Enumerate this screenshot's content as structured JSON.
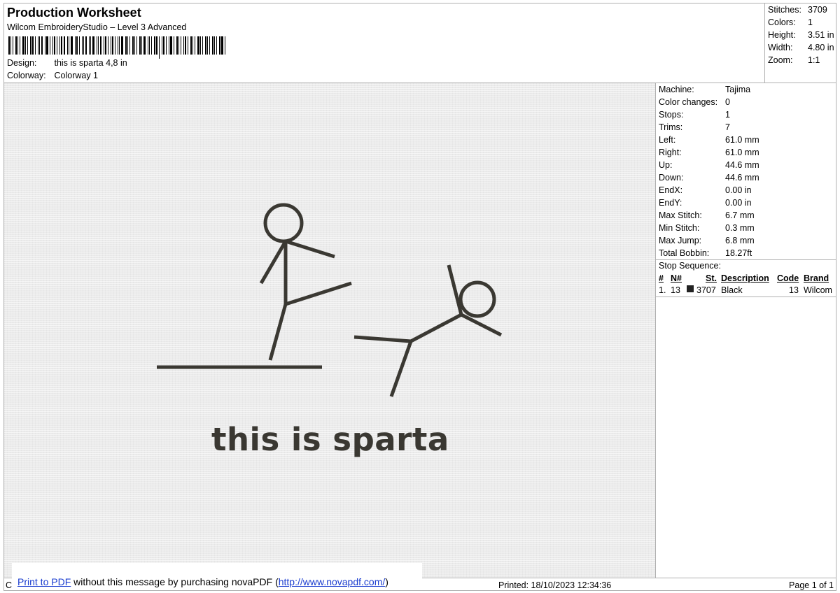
{
  "header": {
    "title": "Production Worksheet",
    "software": "Wilcom EmbroideryStudio – Level 3 Advanced",
    "design_label": "Design:",
    "design_value": "this is sparta 4,8 in",
    "colorway_label": "Colorway:",
    "colorway_value": "Colorway 1"
  },
  "summary": [
    {
      "label": "Stitches:",
      "value": "3709"
    },
    {
      "label": "Colors:",
      "value": "1"
    },
    {
      "label": "Height:",
      "value": "3.51 in"
    },
    {
      "label": "Width:",
      "value": "4.80 in"
    },
    {
      "label": "Zoom:",
      "value": "1:1"
    }
  ],
  "design_text": "this is sparta",
  "stats": [
    {
      "label": "Machine:",
      "value": "Tajima"
    },
    {
      "label": "Color changes:",
      "value": "0"
    },
    {
      "label": "Stops:",
      "value": "1"
    },
    {
      "label": "Trims:",
      "value": "7"
    },
    {
      "label": "Left:",
      "value": "61.0 mm"
    },
    {
      "label": "Right:",
      "value": "61.0 mm"
    },
    {
      "label": "Up:",
      "value": "44.6 mm"
    },
    {
      "label": "Down:",
      "value": "44.6 mm"
    },
    {
      "label": "EndX:",
      "value": "0.00 in"
    },
    {
      "label": "EndY:",
      "value": "0.00 in"
    },
    {
      "label": "Max Stitch:",
      "value": "6.7 mm"
    },
    {
      "label": "Min Stitch:",
      "value": "0.3 mm"
    },
    {
      "label": "Max Jump:",
      "value": "6.8 mm"
    },
    {
      "label": "Total Bobbin:",
      "value": "18.27ft"
    }
  ],
  "stop_sequence": {
    "heading": "Stop Sequence:",
    "columns": {
      "num": "#",
      "needle": "N#",
      "stitches": "St.",
      "description": "Description",
      "code": "Code",
      "brand": "Brand"
    },
    "rows": [
      {
        "num": "1.",
        "needle": "13",
        "swatch_color": "#222222",
        "stitches": "3707",
        "description": "Black",
        "code": "13",
        "brand": "Wilcom"
      }
    ]
  },
  "footer": {
    "cr": "Cr",
    "printed": "Printed: 18/10/2023 12:34:36",
    "page": "Page 1 of 1"
  },
  "banner": {
    "link1": "Print to PDF",
    "middle": " without this message by purchasing novaPDF (",
    "link2": "http://www.novapdf.com/",
    "end": ")"
  },
  "colors": {
    "thread": "#3a3832",
    "border": "#b0b0b0",
    "link": "#1a3ccf"
  }
}
